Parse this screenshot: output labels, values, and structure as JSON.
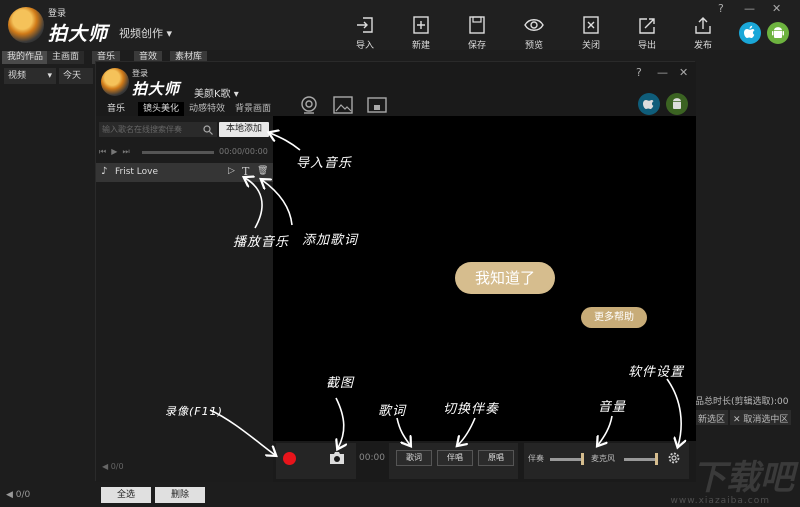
{
  "app": {
    "login": "登录",
    "name": "拍大师",
    "mode": "视频创作"
  },
  "toolbar": [
    {
      "key": "import",
      "label": "导入"
    },
    {
      "key": "new",
      "label": "新建"
    },
    {
      "key": "save",
      "label": "保存"
    },
    {
      "key": "preview",
      "label": "预览"
    },
    {
      "key": "close",
      "label": "关闭"
    },
    {
      "key": "export",
      "label": "导出"
    },
    {
      "key": "publish",
      "label": "发布"
    }
  ],
  "win_controls": [
    "?",
    "—",
    "✕"
  ],
  "behind": {
    "tabs": [
      "我的作品",
      "主画面",
      "音乐",
      "音效",
      "素材库"
    ],
    "select_value": "视频",
    "date_filter": "今天",
    "page": "0/0",
    "select_all": "全选",
    "delete": "删除",
    "right_info": "品总时长(剪辑选取):00",
    "new_range": "新选区",
    "cancel_range": "取消选中区"
  },
  "dialog": {
    "login": "登录",
    "name": "拍大师",
    "mode": "美颜K歌",
    "win_controls": [
      "?",
      "—",
      "✕"
    ],
    "tabs": [
      "音乐",
      "镜头美化",
      "动感特效",
      "背景画面"
    ],
    "search_placeholder": "输入歌名在线搜索伴奏",
    "add_local": "本地添加",
    "time": "00:00/00:00",
    "song": "Frist Love",
    "page": "0/0",
    "know_button": "我知道了",
    "more_help": "更多帮助",
    "rec_time": "00:00",
    "lyrics_btn": "歌词",
    "accomp_btn": "伴唱",
    "original_btn": "原唱",
    "accomp_label": "伴奏",
    "mic_label": "麦克风"
  },
  "annotations": {
    "import_music": "导入音乐",
    "play_music": "播放音乐",
    "add_lyrics": "添加歌词",
    "record": "录像(F11)",
    "screenshot": "截图",
    "lyrics": "歌词",
    "switch_accomp": "切换伴奏",
    "volume": "音量",
    "settings": "软件设置"
  },
  "watermark": {
    "text": "下载吧",
    "url": "www.xiazaiba.com"
  },
  "colors": {
    "record": "#e8141b",
    "gold": "#d6bd8e",
    "ios": "#1aa7d8",
    "android": "#6db33f"
  }
}
